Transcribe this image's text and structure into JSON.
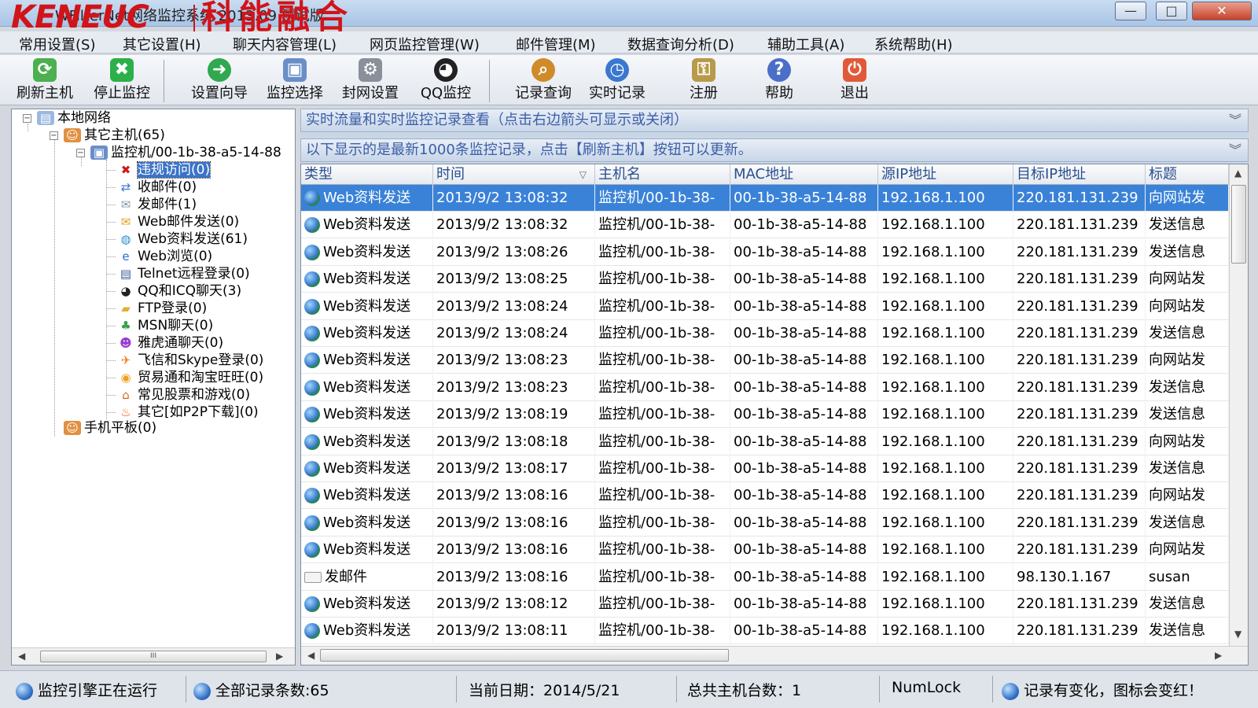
{
  "window": {
    "logo_text": "KENEUC",
    "logo_cn": "科能融合",
    "title": "WFilterNet网络监控系统 2013.09 测试版",
    "buttons": {
      "minimize": "—",
      "maximize": "□",
      "close": "✕"
    }
  },
  "menu": [
    "常用设置(S)",
    "其它设置(H)",
    "聊天内容管理(L)",
    "网页监控管理(W)",
    "邮件管理(M)",
    "数据查询分析(D)",
    "辅助工具(A)",
    "系统帮助(H)"
  ],
  "toolbar": [
    {
      "label": "刷新主机",
      "icon": "refresh-icon",
      "color": "#4caf50",
      "glyph": "⟳"
    },
    {
      "label": "停止监控",
      "icon": "stop-icon",
      "color": "#2db04a",
      "glyph": "✖"
    },
    {
      "label": "设置向导",
      "icon": "wizard-icon",
      "color": "#2fa84f",
      "glyph": "➜"
    },
    {
      "label": "监控选择",
      "icon": "computer-icon",
      "color": "#6a8fc8",
      "glyph": "▣"
    },
    {
      "label": "封网设置",
      "icon": "network-icon",
      "color": "#8a9099",
      "glyph": "⚙"
    },
    {
      "label": "QQ监控",
      "icon": "qq-penguin-icon",
      "color": "#222222",
      "glyph": "◕"
    },
    {
      "label": "记录查询",
      "icon": "magnifier-icon",
      "color": "#d08a2a",
      "glyph": "⌕"
    },
    {
      "label": "实时记录",
      "icon": "clock-icon",
      "color": "#3a78d0",
      "glyph": "◷"
    },
    {
      "label": "注册",
      "icon": "key-icon",
      "color": "#b89a4a",
      "glyph": "⚿"
    },
    {
      "label": "帮助",
      "icon": "help-icon",
      "color": "#4a6fc8",
      "glyph": "?"
    },
    {
      "label": "退出",
      "icon": "exit-icon",
      "color": "#e05a3a",
      "glyph": "⏻"
    }
  ],
  "tree": {
    "root": "本地网络",
    "group": "其它主机(65)",
    "host": "监控机/00-1b-38-a5-14-88",
    "items": [
      {
        "label": "违规访问(0)",
        "icon": "red-x-icon",
        "color": "#d01818",
        "glyph": "✖"
      },
      {
        "label": "收邮件(0)",
        "icon": "receive-mail-icon",
        "color": "#3a7ad0",
        "glyph": "⇄"
      },
      {
        "label": "发邮件(1)",
        "icon": "envelope-icon",
        "color": "#8899aa",
        "glyph": "✉"
      },
      {
        "label": "Web邮件发送(0)",
        "icon": "web-mail-icon",
        "color": "#e0a020",
        "glyph": "✉"
      },
      {
        "label": "Web资料发送(61)",
        "icon": "globe-icon",
        "color": "#2a8fd0",
        "glyph": "◍"
      },
      {
        "label": "Web浏览(0)",
        "icon": "ie-browser-icon",
        "color": "#2a6fd0",
        "glyph": "e"
      },
      {
        "label": "Telnet远程登录(0)",
        "icon": "terminal-icon",
        "color": "#3a5a9a",
        "glyph": "▤"
      },
      {
        "label": "QQ和ICQ聊天(3)",
        "icon": "qq-icon",
        "color": "#222222",
        "glyph": "◕"
      },
      {
        "label": "FTP登录(0)",
        "icon": "folder-icon",
        "color": "#e0b030",
        "glyph": "▰"
      },
      {
        "label": "MSN聊天(0)",
        "icon": "msn-icon",
        "color": "#3aa04a",
        "glyph": "♣"
      },
      {
        "label": "雅虎通聊天(0)",
        "icon": "yahoo-icon",
        "color": "#9a3ad0",
        "glyph": "☻"
      },
      {
        "label": "飞信和Skype登录(0)",
        "icon": "fetion-icon",
        "color": "#f08020",
        "glyph": "✈"
      },
      {
        "label": "贸易通和淘宝旺旺(0)",
        "icon": "wangwang-icon",
        "color": "#f0a020",
        "glyph": "◉"
      },
      {
        "label": "常见股票和游戏(0)",
        "icon": "house-icon",
        "color": "#d06a20",
        "glyph": "⌂"
      },
      {
        "label": "其它[如P2P下载](0)",
        "icon": "fire-icon",
        "color": "#f05a10",
        "glyph": "♨"
      }
    ],
    "mobile": "手机平板(0)",
    "scroll_thumb": "III"
  },
  "info_bars": {
    "realtime": "实时流量和实时监控记录查看（点击右边箭头可显示或关闭）",
    "latest": "以下显示的是最新1000条监控记录，点击【刷新主机】按钮可以更新。",
    "chevron": "︾"
  },
  "grid": {
    "columns": [
      "类型",
      "时间",
      "主机名",
      "MAC地址",
      "源IP地址",
      "目标IP地址",
      "标题"
    ],
    "sort_indicator": "▽",
    "rows": [
      [
        "Web资料发送",
        "2013/9/2 13:08:32",
        "监控机/00-1b-38-",
        "00-1b-38-a5-14-88",
        "192.168.1.100",
        "220.181.131.239",
        "向网站发"
      ],
      [
        "Web资料发送",
        "2013/9/2 13:08:32",
        "监控机/00-1b-38-",
        "00-1b-38-a5-14-88",
        "192.168.1.100",
        "220.181.131.239",
        "发送信息"
      ],
      [
        "Web资料发送",
        "2013/9/2 13:08:26",
        "监控机/00-1b-38-",
        "00-1b-38-a5-14-88",
        "192.168.1.100",
        "220.181.131.239",
        "发送信息"
      ],
      [
        "Web资料发送",
        "2013/9/2 13:08:25",
        "监控机/00-1b-38-",
        "00-1b-38-a5-14-88",
        "192.168.1.100",
        "220.181.131.239",
        "向网站发"
      ],
      [
        "Web资料发送",
        "2013/9/2 13:08:24",
        "监控机/00-1b-38-",
        "00-1b-38-a5-14-88",
        "192.168.1.100",
        "220.181.131.239",
        "向网站发"
      ],
      [
        "Web资料发送",
        "2013/9/2 13:08:24",
        "监控机/00-1b-38-",
        "00-1b-38-a5-14-88",
        "192.168.1.100",
        "220.181.131.239",
        "发送信息"
      ],
      [
        "Web资料发送",
        "2013/9/2 13:08:23",
        "监控机/00-1b-38-",
        "00-1b-38-a5-14-88",
        "192.168.1.100",
        "220.181.131.239",
        "向网站发"
      ],
      [
        "Web资料发送",
        "2013/9/2 13:08:23",
        "监控机/00-1b-38-",
        "00-1b-38-a5-14-88",
        "192.168.1.100",
        "220.181.131.239",
        "发送信息"
      ],
      [
        "Web资料发送",
        "2013/9/2 13:08:19",
        "监控机/00-1b-38-",
        "00-1b-38-a5-14-88",
        "192.168.1.100",
        "220.181.131.239",
        "发送信息"
      ],
      [
        "Web资料发送",
        "2013/9/2 13:08:18",
        "监控机/00-1b-38-",
        "00-1b-38-a5-14-88",
        "192.168.1.100",
        "220.181.131.239",
        "向网站发"
      ],
      [
        "Web资料发送",
        "2013/9/2 13:08:17",
        "监控机/00-1b-38-",
        "00-1b-38-a5-14-88",
        "192.168.1.100",
        "220.181.131.239",
        "发送信息"
      ],
      [
        "Web资料发送",
        "2013/9/2 13:08:16",
        "监控机/00-1b-38-",
        "00-1b-38-a5-14-88",
        "192.168.1.100",
        "220.181.131.239",
        "向网站发"
      ],
      [
        "Web资料发送",
        "2013/9/2 13:08:16",
        "监控机/00-1b-38-",
        "00-1b-38-a5-14-88",
        "192.168.1.100",
        "220.181.131.239",
        "发送信息"
      ],
      [
        "Web资料发送",
        "2013/9/2 13:08:16",
        "监控机/00-1b-38-",
        "00-1b-38-a5-14-88",
        "192.168.1.100",
        "220.181.131.239",
        "向网站发"
      ],
      [
        "发邮件",
        "2013/9/2 13:08:16",
        "监控机/00-1b-38-",
        "00-1b-38-a5-14-88",
        "192.168.1.100",
        "98.130.1.167",
        "susan"
      ],
      [
        "Web资料发送",
        "2013/9/2 13:08:12",
        "监控机/00-1b-38-",
        "00-1b-38-a5-14-88",
        "192.168.1.100",
        "220.181.131.239",
        "发送信息"
      ],
      [
        "Web资料发送",
        "2013/9/2 13:08:11",
        "监控机/00-1b-38-",
        "00-1b-38-a5-14-88",
        "192.168.1.100",
        "220.181.131.239",
        "发送信息"
      ]
    ],
    "selected_row": 0
  },
  "status": {
    "engine": "监控引擎正在运行",
    "records": "全部记录条数:65",
    "date": "当前日期：2014/5/21",
    "hosts": "总共主机台数：1",
    "numlock": "NumLock",
    "hint": "记录有变化，图标会变红！"
  }
}
